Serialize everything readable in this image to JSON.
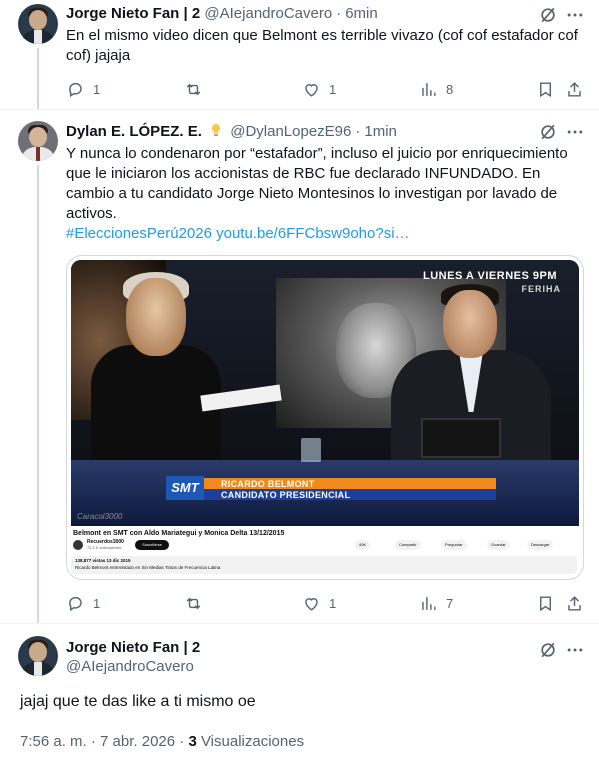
{
  "tweets": [
    {
      "name": "Jorge Nieto Fan | 2",
      "handle": "@AIejandroCavero",
      "time": "6min",
      "text": "En el mismo video dicen que Belmont es terrible vivazo (cof cof estafador cof cof) jajaja",
      "replies": "1",
      "retweets": "",
      "likes": "1",
      "views": "8"
    },
    {
      "name": "Dylan E. LÓPEZ. E.",
      "handle": "@DylanLopezE96",
      "time": "1min",
      "text": "Y nunca lo condenaron por “estafador”, incluso el juicio por enriquecimiento que le iniciaron los accionistas de RBC fue declarado INFUNDADO. En cambio a tu candidato Jorge Nieto Montesinos lo investigan por lavado de activos.",
      "hashtag": "#EleccionesPerú2026",
      "link": "youtu.be/6FFCbsw9oho?si…",
      "replies": "1",
      "retweets": "",
      "likes": "1",
      "views": "7"
    }
  ],
  "media": {
    "promo": "LUNES A VIERNES 9PM",
    "promo_sub": "FERIHA",
    "lower_logo": "SMT",
    "lower_name": "RICARDO BELMONT",
    "lower_role": "CANDIDATO PRESIDENCIAL",
    "channel_tag": "Caracol3000",
    "yt_title": "Belmont en SMT con Aldo Mariategui y Monica Delta 13/12/2015",
    "yt_channel": "Recuerdos3000",
    "yt_subs": "72.1 K suscriptores",
    "yt_subscribe": "Suscribirse",
    "yt_actions": [
      "49K",
      "Compartir",
      "Preguntar",
      "Guardar",
      "Descargar"
    ],
    "yt_desc_1": "138,877 vistas  13 dic 2015",
    "yt_desc_2": "Ricardo Belmont entrevistado en Sin Medias Tintas de Frecuencia Latina"
  },
  "main": {
    "name": "Jorge Nieto Fan | 2",
    "handle": "@AIejandroCavero",
    "text": "jajaj que te das like a ti mismo oe",
    "timestamp": "7:56 a. m. · 7 abr. 2026 · ",
    "views_count": "3",
    "views_label": " Visualizaciones"
  },
  "colors": {
    "accent": "#1d9bf0",
    "secondary_text": "#536471",
    "thread_line": "#cfd9de"
  },
  "icons": [
    "grok-icon",
    "more-icon",
    "reply-icon",
    "retweet-icon",
    "like-icon",
    "views-icon",
    "bookmark-icon",
    "share-icon",
    "lightbulb-icon"
  ]
}
